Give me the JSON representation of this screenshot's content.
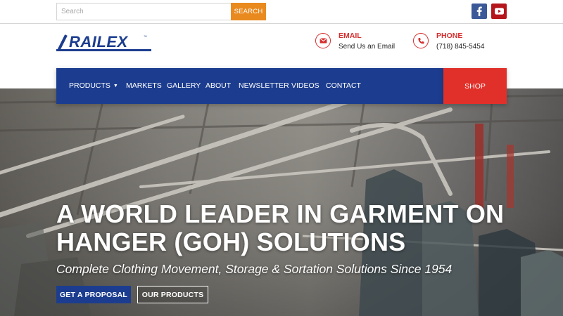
{
  "topbar": {
    "search_placeholder": "Search",
    "search_button": "SEARCH",
    "social": [
      "facebook-icon",
      "youtube-icon"
    ]
  },
  "brand": {
    "logo_text": "RAILEX",
    "color": "#1c3d8f"
  },
  "contact": {
    "email": {
      "title": "EMAIL",
      "value": "Send Us an Email",
      "icon": "envelope-icon"
    },
    "phone": {
      "title": "PHONE",
      "value": "(718) 845-5454",
      "icon": "phone-icon"
    }
  },
  "nav": {
    "items": [
      "PRODUCTS",
      "MARKETS",
      "GALLERY",
      "ABOUT",
      "NEWSLETTER",
      "VIDEOS",
      "CONTACT"
    ],
    "shop": "SHOP"
  },
  "hero": {
    "headline": "A WORLD LEADER IN GARMENT ON HANGER (GOH) SOLUTIONS",
    "tagline": "Complete Clothing Movement, Storage & Sortation Solutions Since 1954",
    "primary_button": "GET A PROPOSAL",
    "secondary_button": "OUR PRODUCTS"
  },
  "colors": {
    "nav_blue": "#1c3d8f",
    "accent_red": "#e1302a",
    "search_orange": "#e98a1f"
  }
}
